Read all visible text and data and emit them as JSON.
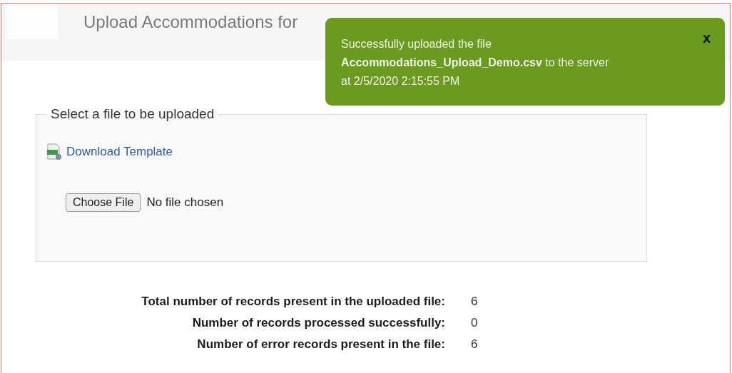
{
  "page": {
    "title": "Upload Accommodations for"
  },
  "toast": {
    "message_lines": [
      "Successfully uploaded the file",
      "**Accommodations_Upload_Demo.csv** to the server",
      "at 2/5/2020 2:15:55 PM"
    ],
    "close": "x"
  },
  "upload": {
    "legend": "Select a file to be uploaded",
    "template_link": "Download Template",
    "file_button": "Choose File",
    "file_status": "No file chosen"
  },
  "stats": [
    {
      "label": "Total number of records present in the uploaded file:",
      "value": "6"
    },
    {
      "label": "Number of records processed successfully:",
      "value": "0"
    },
    {
      "label": "Number of error records present in the file:",
      "value": "6"
    }
  ]
}
